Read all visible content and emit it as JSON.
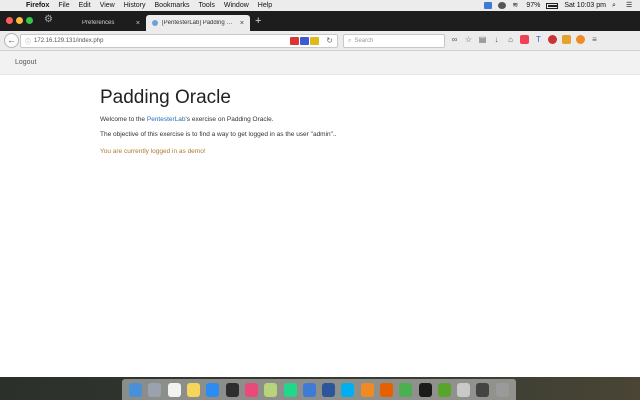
{
  "menubar": {
    "app_name": "Firefox",
    "items": [
      "File",
      "Edit",
      "View",
      "History",
      "Bookmarks",
      "Tools",
      "Window",
      "Help"
    ],
    "battery_percent": "97%",
    "battery_level": 0.97,
    "clock": "Sat 10:03 pm"
  },
  "tabs": {
    "inactive_label": "Preferences",
    "active_label": "[PentesterLab] Padding Ora...",
    "close_glyph": "×",
    "new_tab_glyph": "+"
  },
  "navbar": {
    "url": "172.16.129.131/index.php",
    "search_placeholder": "Search"
  },
  "page": {
    "logout_label": "Logout",
    "title": "Padding Oracle",
    "intro_before": "Welcome to the ",
    "intro_link": "PentesterLab",
    "intro_after": "'s exercise on Padding Oracle.",
    "objective": "The objective of this exercise is to find a way to get logged in as the user \"admin\"..",
    "status": "You are currently logged in as demo!"
  },
  "colors": {
    "link": "#2a6ebb",
    "status": "#b07a2f",
    "active_tab": "#ececec"
  },
  "dock_icons": [
    "finder-icon",
    "launchpad-icon",
    "calendar-icon",
    "notes-icon",
    "app-store-icon",
    "terminal-icon",
    "itunes-icon",
    "notepad-icon",
    "pycharm-icon",
    "mail-icon",
    "word-icon",
    "skype-icon",
    "vlc-icon",
    "firefox-icon",
    "chrome-icon",
    "terminal2-icon",
    "utorrent-icon",
    "preview-icon",
    "screenshot-icon",
    "trash-icon"
  ]
}
